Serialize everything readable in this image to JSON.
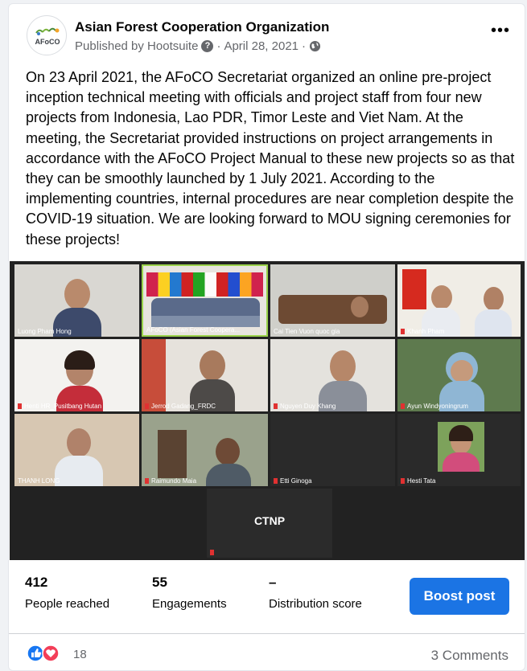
{
  "post": {
    "page_name": "Asian Forest Cooperation Organization",
    "avatar_text": "AFoCO",
    "published_by": "Published by Hootsuite",
    "separator": "·",
    "date": "April 28, 2021",
    "more_label": "•••",
    "body": "On 23 April 2021, the AFoCO Secretariat organized an online pre-project inception technical meeting with officials and project staff from four new projects from Indonesia, Lao PDR, Timor Leste and Viet Nam. At the meeting, the Secretariat provided instructions on project arrangements in accordance with the AFoCO Project Manual to these new projects so as that they can be smoothly launched by 1 July 2021. According to the implementing countries,  internal procedures are near completion despite the COVID-19 situation.  We are looking forward to MOU signing ceremonies for these projects!"
  },
  "video": {
    "participants": [
      "Luong Pham Hong",
      "AFoCO (Asian Forest Coopera...",
      "Cai Tien Vuon quoc gia",
      "Khanh Pham",
      "Henti HR_Pusitbang Hutan",
      "Jerrod Gadang_FRDC",
      "Nguyen Duy Khang",
      "Ayun Windyoningrum",
      "THANH LONG",
      "Raimundo Maia",
      "Etti Ginoga",
      "Hesti Tata"
    ],
    "ctnp_label": "CTNP"
  },
  "stats": {
    "reached_value": "412",
    "reached_label": "People reached",
    "engagements_value": "55",
    "engagements_label": "Engagements",
    "distribution_value": "–",
    "distribution_label": "Distribution score",
    "boost_label": "Boost post"
  },
  "reactions": {
    "count": "18",
    "comments": "3 Comments"
  },
  "colors": {
    "accent": "#1b74e4",
    "like": "#1877f2",
    "love": "#f33e58",
    "muted": "#65676b"
  }
}
